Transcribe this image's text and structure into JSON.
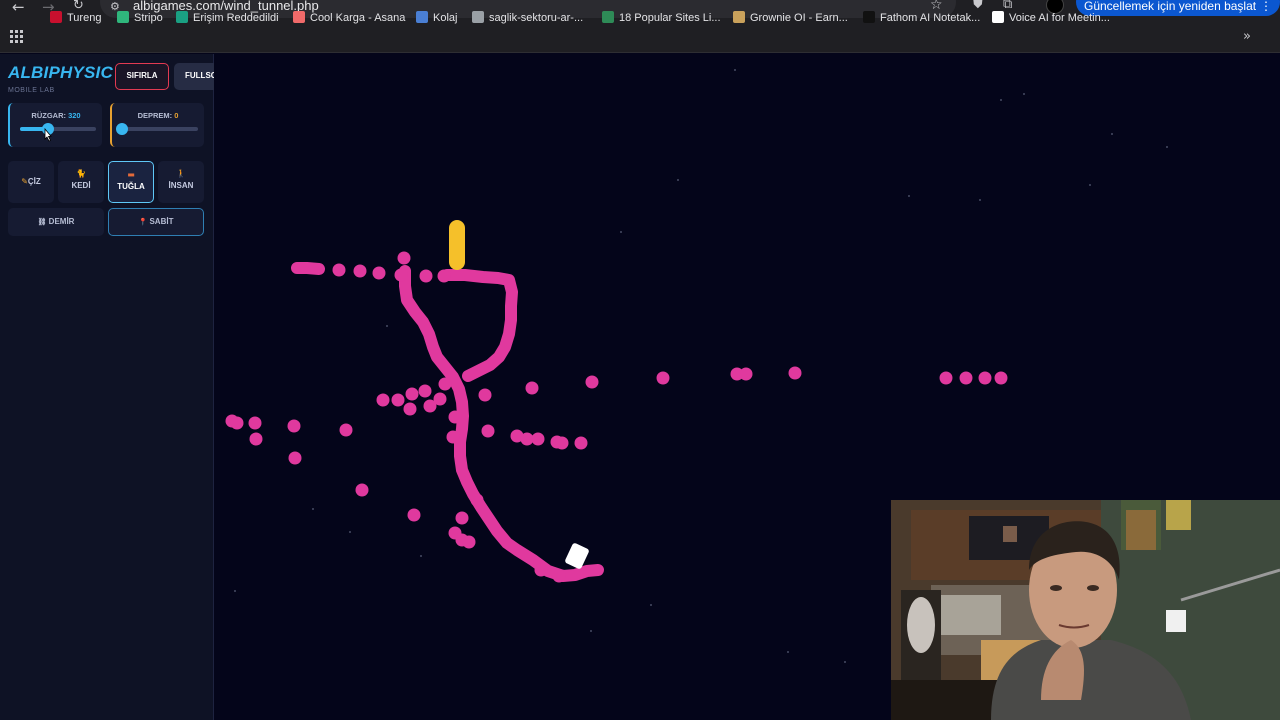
{
  "browser": {
    "url": "albigames.com/wind_tunnel.php",
    "update_button": "Güncellemek için yeniden başlat",
    "bookmarks": [
      {
        "label": "Tureng",
        "color": "#c8102e"
      },
      {
        "label": "Stripo",
        "color": "#2fb67c"
      },
      {
        "label": "Erişim Reddedildi",
        "color": "#1aa083"
      },
      {
        "label": "Cool Karga - Asana",
        "color": "#f06a6a"
      },
      {
        "label": "Kolaj",
        "color": "#4a7fd4"
      },
      {
        "label": "saglik-sektoru-ar-...",
        "color": "#9aa0a6"
      },
      {
        "label": "18 Popular Sites Li...",
        "color": "#2e8b57"
      },
      {
        "label": "Grownie OI - Earn...",
        "color": "#c9a15b"
      },
      {
        "label": "Fathom AI Notetak...",
        "color": "#111111"
      },
      {
        "label": "Voice AI for Meetin...",
        "color": "#ffffff"
      }
    ]
  },
  "app": {
    "logo": "ALBIPHYSIC",
    "logo_sub": "MOBILE LAB",
    "reset_label": "SIFIRLA",
    "fullscreen_label": "FULLSC",
    "wind": {
      "label": "RÜZGAR:",
      "value": "320",
      "fraction": 0.37
    },
    "quake": {
      "label": "DEPREM:",
      "value": "0",
      "fraction": 0.0
    },
    "tools": [
      {
        "label": "ÇİZ",
        "icon": "pencil-icon"
      },
      {
        "label": "KEDİ",
        "icon": "cat-icon"
      },
      {
        "label": "TUĞLA",
        "icon": "brick-icon",
        "active": true
      },
      {
        "label": "İNSAN",
        "icon": "person-icon"
      }
    ],
    "iron_label": "DEMİR",
    "fixed_label": "SABİT"
  },
  "colors": {
    "accent": "#38b6f0",
    "reset_border": "#e33a52",
    "quake_accent": "#e8a231",
    "particle": "#e0399e",
    "yellow_block": "#f5c02a",
    "white_block": "#ffffff",
    "canvas_bg": "#04051a"
  }
}
